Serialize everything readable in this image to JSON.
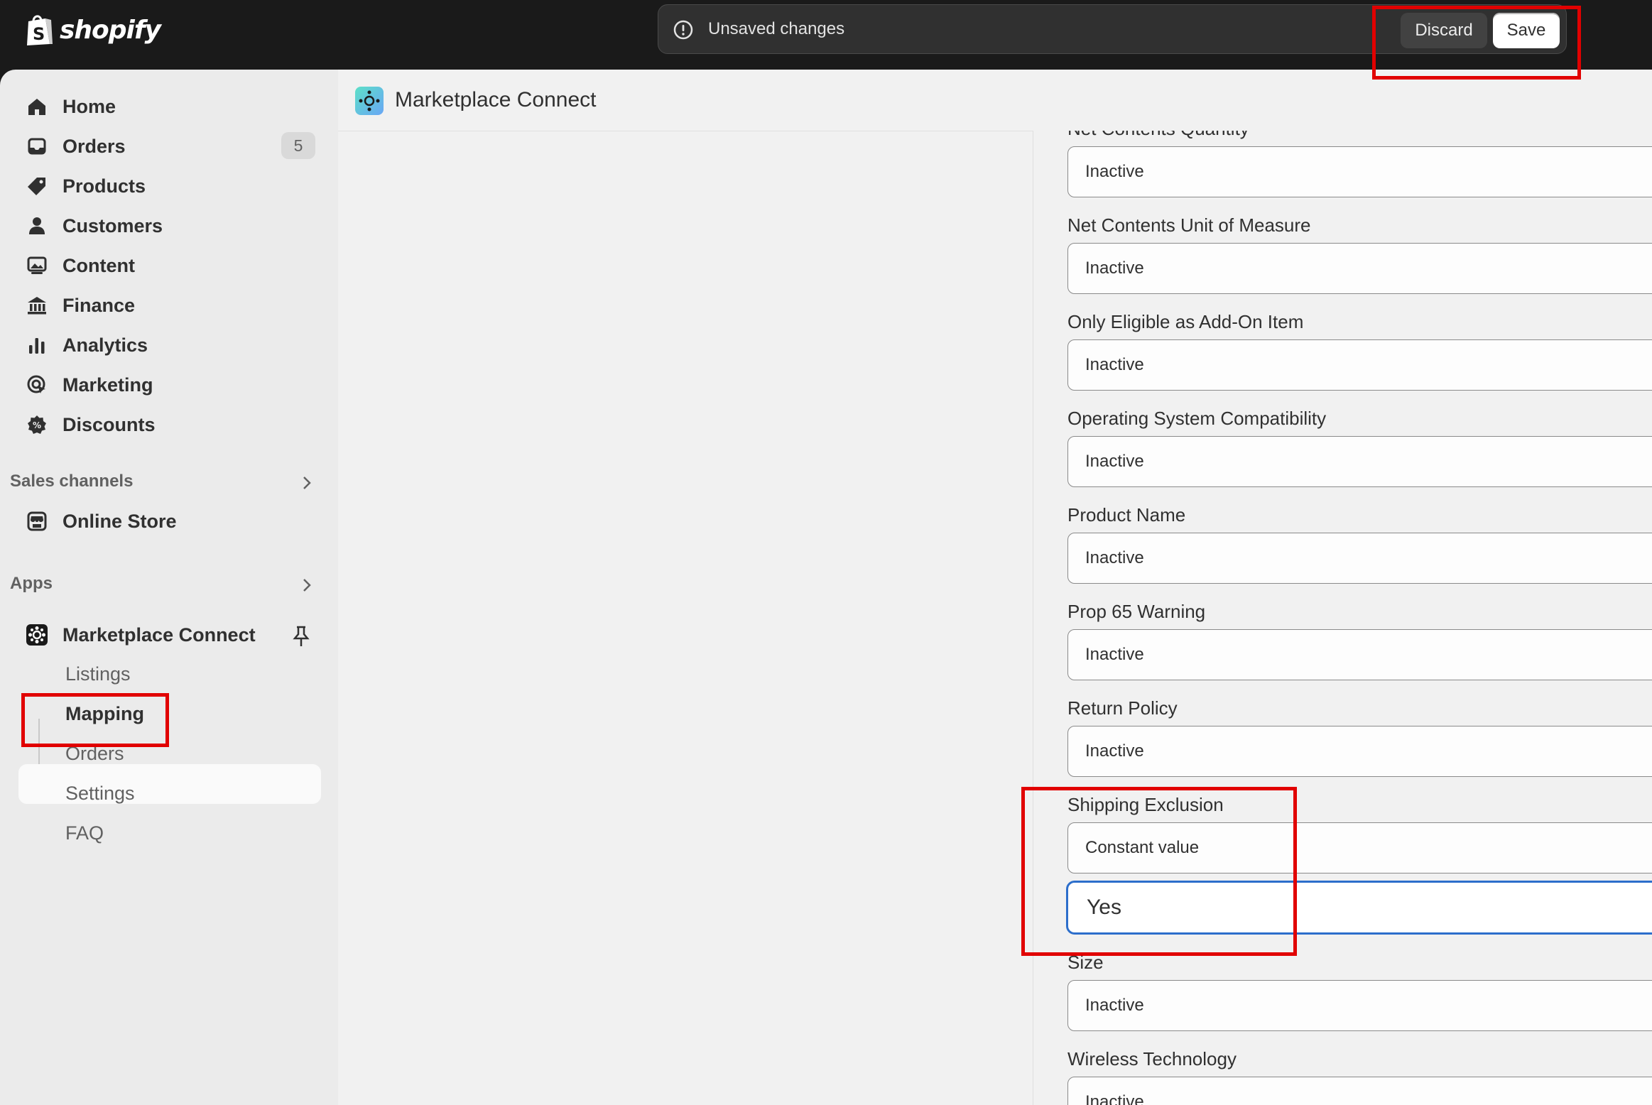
{
  "topbar": {
    "logo_text": "shopify",
    "unsaved_text": "Unsaved changes",
    "discard_label": "Discard",
    "save_label": "Save"
  },
  "sidebar": {
    "items": [
      {
        "label": "Home",
        "icon": "home-icon"
      },
      {
        "label": "Orders",
        "icon": "inbox-icon",
        "badge": "5"
      },
      {
        "label": "Products",
        "icon": "tag-icon"
      },
      {
        "label": "Customers",
        "icon": "person-icon"
      },
      {
        "label": "Content",
        "icon": "image-icon"
      },
      {
        "label": "Finance",
        "icon": "bank-icon"
      },
      {
        "label": "Analytics",
        "icon": "bar-chart-icon"
      },
      {
        "label": "Marketing",
        "icon": "target-icon"
      },
      {
        "label": "Discounts",
        "icon": "discount-icon"
      }
    ],
    "sales_channels_label": "Sales channels",
    "online_store_label": "Online Store",
    "apps_label": "Apps",
    "app_name": "Marketplace Connect",
    "app_subitems": [
      "Listings",
      "Mapping",
      "Orders",
      "Settings",
      "FAQ"
    ],
    "active_subitem": "Mapping"
  },
  "main": {
    "app_title": "Marketplace Connect",
    "fields": [
      {
        "label": "Net Contents Quantity",
        "value": "Inactive"
      },
      {
        "label": "Net Contents Unit of Measure",
        "value": "Inactive"
      },
      {
        "label": "Only Eligible as Add-On Item",
        "value": "Inactive"
      },
      {
        "label": "Operating System Compatibility",
        "value": "Inactive"
      },
      {
        "label": "Product Name",
        "value": "Inactive"
      },
      {
        "label": "Prop 65 Warning",
        "value": "Inactive"
      },
      {
        "label": "Return Policy",
        "value": "Inactive"
      },
      {
        "label": "Shipping Exclusion",
        "value": "Constant value",
        "input_value": "Yes"
      },
      {
        "label": "Size",
        "value": "Inactive"
      },
      {
        "label": "Wireless Technology",
        "value": "Inactive"
      }
    ]
  },
  "colors": {
    "highlight": "#e10000",
    "focus": "#2c6ecb",
    "topbar": "#1a1a1a"
  }
}
